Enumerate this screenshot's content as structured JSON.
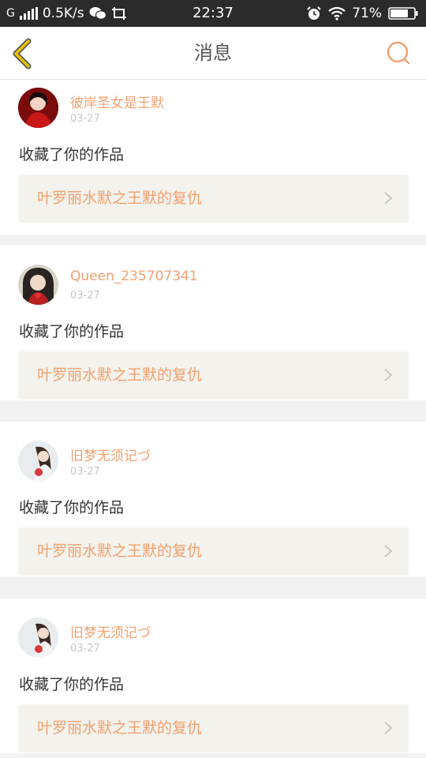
{
  "status_bar": {
    "network": "G",
    "speed": "0.5K/s",
    "time": "22:37",
    "battery": "71%"
  },
  "header": {
    "title": "消息"
  },
  "colors": {
    "accent": "#f0a070",
    "back_arrow": "#e8c200"
  },
  "messages": [
    {
      "username": "彼岸圣女是王默",
      "date": "03-27",
      "action": "收藏了你的作品",
      "work_title": "叶罗丽水默之王默的复仇"
    },
    {
      "username": "Queen_235707341",
      "date": "03-27",
      "action": "收藏了你的作品",
      "work_title": "叶罗丽水默之王默的复仇"
    },
    {
      "username": "旧梦无须记づ",
      "date": "03-27",
      "action": "收藏了你的作品",
      "work_title": "叶罗丽水默之王默的复仇"
    },
    {
      "username": "旧梦无须记づ",
      "date": "03-27",
      "action": "收藏了你的作品",
      "work_title": "叶罗丽水默之王默的复仇"
    }
  ]
}
